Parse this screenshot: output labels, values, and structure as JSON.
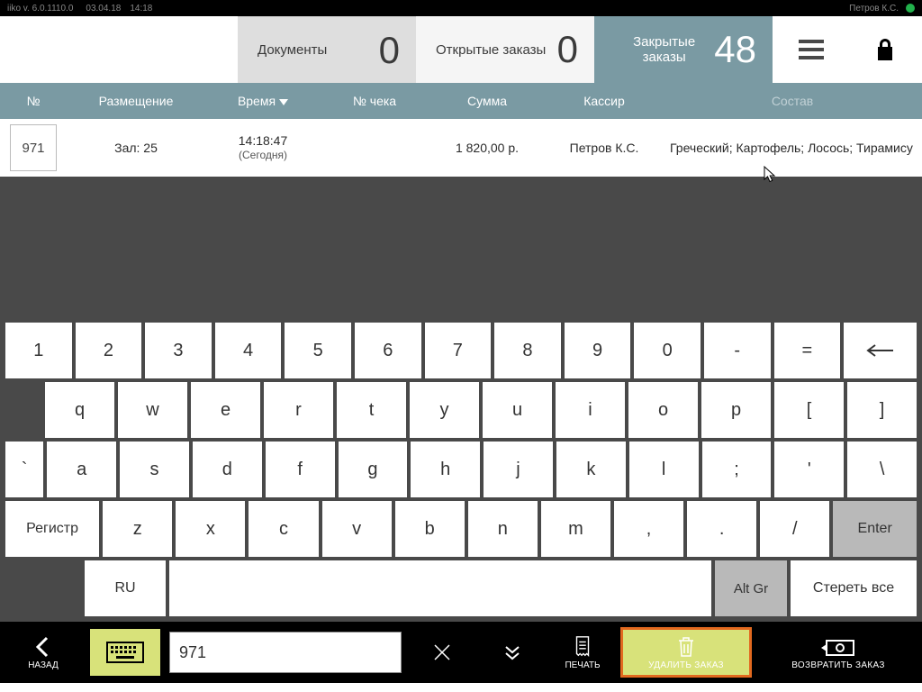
{
  "status": {
    "app": "iiko  v. 6.0.1110.0",
    "date": "03.04.18",
    "time": "14:18",
    "user": "Петров К.С."
  },
  "tabs": {
    "docs": {
      "label": "Документы",
      "count": "0"
    },
    "open": {
      "label": "Открытые заказы",
      "count": "0"
    },
    "closed": {
      "label": "Закрытые заказы",
      "count": "48"
    }
  },
  "columns": {
    "no": "№",
    "place": "Размещение",
    "time": "Время",
    "check": "№ чека",
    "sum": "Сумма",
    "cashier": "Кассир",
    "items": "Состав"
  },
  "row": {
    "no": "971",
    "place": "Зал: 25",
    "time": "14:18:47",
    "time_sub": "(Сегодня)",
    "check": "",
    "sum": "1 820,00 р.",
    "cashier": "Петров К.С.",
    "items": "Греческий; Картофель; Лосось; Тирамису"
  },
  "keyboard": {
    "r1": [
      "1",
      "2",
      "3",
      "4",
      "5",
      "6",
      "7",
      "8",
      "9",
      "0",
      "-",
      "="
    ],
    "r2": [
      "q",
      "w",
      "e",
      "r",
      "t",
      "y",
      "u",
      "i",
      "o",
      "p",
      "[",
      "]"
    ],
    "r3": [
      "`",
      "a",
      "s",
      "d",
      "f",
      "g",
      "h",
      "j",
      "k",
      "l",
      ";",
      "'",
      "\\"
    ],
    "r4": [
      "z",
      "x",
      "c",
      "v",
      "b",
      "n",
      "m",
      ",",
      ".",
      "/"
    ],
    "shift": "Регистр",
    "enter": "Enter",
    "lang": "RU",
    "altgr": "Alt Gr",
    "clear": "Стереть все"
  },
  "search": {
    "value": "971"
  },
  "bottom": {
    "back": "НАЗАД",
    "print": "ПЕЧАТЬ",
    "delete": "УДАЛИТЬ ЗАКАЗ",
    "refund": "ВОЗВРАТИТЬ ЗАКАЗ"
  }
}
